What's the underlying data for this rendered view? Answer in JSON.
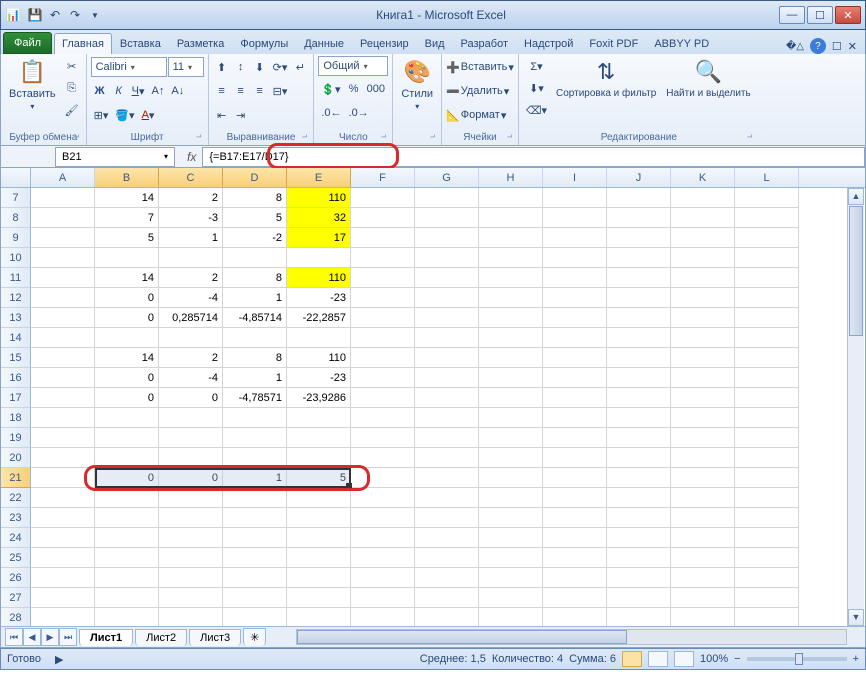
{
  "window": {
    "title": "Книга1 - Microsoft Excel"
  },
  "tabs": {
    "file": "Файл",
    "items": [
      "Главная",
      "Вставка",
      "Разметка",
      "Формулы",
      "Данные",
      "Рецензир",
      "Вид",
      "Разработ",
      "Надстрой",
      "Foxit PDF",
      "ABBYY PD"
    ],
    "active": 0
  },
  "ribbon": {
    "clipboard": {
      "paste": "Вставить",
      "label": "Буфер обмена"
    },
    "font": {
      "name": "Calibri",
      "size": "11",
      "label": "Шрифт"
    },
    "alignment": {
      "label": "Выравнивание"
    },
    "number": {
      "format": "Общий",
      "label": "Число"
    },
    "styles": {
      "btn": "Стили",
      "label": ""
    },
    "cells": {
      "insert": "Вставить",
      "delete": "Удалить",
      "format": "Формат",
      "label": "Ячейки"
    },
    "editing": {
      "sort": "Сортировка и фильтр",
      "find": "Найти и выделить",
      "label": "Редактирование"
    }
  },
  "namebox": "B21",
  "formula": "{=B17:E17/D17}",
  "columns": [
    "A",
    "B",
    "C",
    "D",
    "E",
    "F",
    "G",
    "H",
    "I",
    "J",
    "K",
    "L"
  ],
  "selected_cols": [
    "B",
    "C",
    "D",
    "E"
  ],
  "rows_visible": [
    7,
    8,
    9,
    10,
    11,
    12,
    13,
    14,
    15,
    16,
    17,
    18,
    19,
    20,
    21,
    22,
    23,
    24,
    25,
    26,
    27,
    28
  ],
  "selected_row": 21,
  "grid": {
    "7": {
      "B": "14",
      "C": "2",
      "D": "8",
      "E": "110"
    },
    "8": {
      "B": "7",
      "C": "-3",
      "D": "5",
      "E": "32"
    },
    "9": {
      "B": "5",
      "C": "1",
      "D": "-2",
      "E": "17"
    },
    "11": {
      "B": "14",
      "C": "2",
      "D": "8",
      "E": "110"
    },
    "12": {
      "B": "0",
      "C": "-4",
      "D": "1",
      "E": "-23"
    },
    "13": {
      "B": "0",
      "C": "0,285714",
      "D": "-4,85714",
      "E": "-22,2857"
    },
    "15": {
      "B": "14",
      "C": "2",
      "D": "8",
      "E": "110"
    },
    "16": {
      "B": "0",
      "C": "-4",
      "D": "1",
      "E": "-23"
    },
    "17": {
      "B": "0",
      "C": "0",
      "D": "-4,78571",
      "E": "-23,9286"
    },
    "21": {
      "B": "0",
      "C": "0",
      "D": "1",
      "E": "5"
    }
  },
  "yellow_cells": [
    "E7",
    "E8",
    "E9",
    "E11"
  ],
  "sheets": {
    "items": [
      "Лист1",
      "Лист2",
      "Лист3"
    ],
    "active": 0
  },
  "status": {
    "ready": "Готово",
    "avg_label": "Среднее:",
    "avg": "1,5",
    "count_label": "Количество:",
    "count": "4",
    "sum_label": "Сумма:",
    "sum": "6",
    "zoom": "100%"
  }
}
